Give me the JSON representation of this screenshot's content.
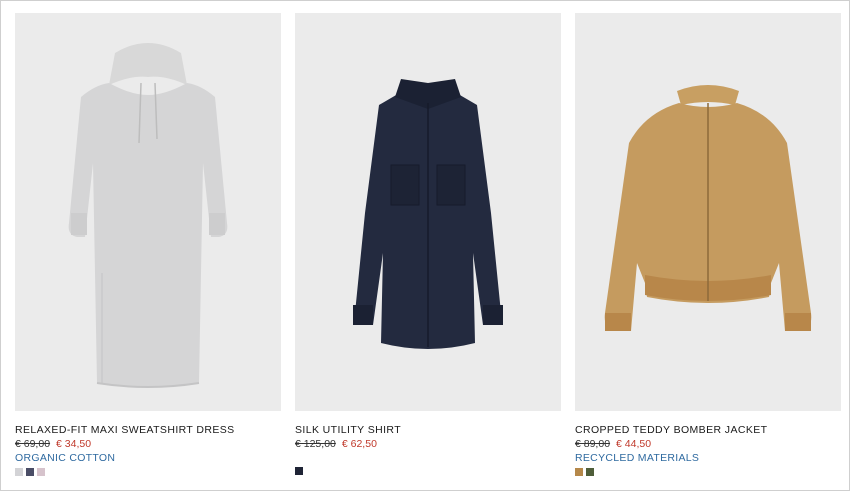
{
  "products": [
    {
      "name": "RELAXED-FIT MAXI SWEATSHIRT DRESS",
      "old_price": "€ 69,00",
      "new_price": "€ 34,50",
      "tag": "ORGANIC COTTON",
      "image_icon": "sweatshirt-dress-image",
      "swatches": [
        "#d3d3d6",
        "#4a4d66",
        "#d6c3cc"
      ]
    },
    {
      "name": "SILK UTILITY SHIRT",
      "old_price": "€ 125,00",
      "new_price": "€ 62,50",
      "tag": "",
      "image_icon": "shirt-image",
      "swatches": [
        "#1f2436"
      ]
    },
    {
      "name": "CROPPED TEDDY BOMBER JACKET",
      "old_price": "€ 89,00",
      "new_price": "€ 44,50",
      "tag": "RECYCLED MATERIALS",
      "image_icon": "bomber-jacket-image",
      "swatches": [
        "#b5884a",
        "#4f5e3a"
      ]
    }
  ],
  "colors": {
    "image_bg": "#ebebeb",
    "sale_price": "#c0392b",
    "tag_link": "#2f6aa0"
  }
}
